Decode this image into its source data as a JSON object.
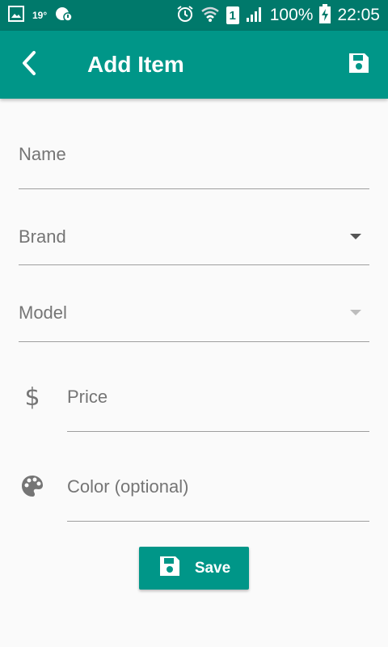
{
  "status_bar": {
    "temperature": "19°",
    "battery": "100%",
    "time": "22:05",
    "sim_slot": "1",
    "icons": [
      "gallery-icon",
      "weather-icon",
      "alarm-icon",
      "wifi-icon",
      "signal-icon",
      "battery-charging-icon"
    ]
  },
  "app_bar": {
    "title": "Add Item",
    "back_icon": "arrow-back-icon",
    "save_icon": "save-icon"
  },
  "form": {
    "name": {
      "placeholder": "Name"
    },
    "brand": {
      "placeholder": "Brand"
    },
    "model": {
      "placeholder": "Model"
    },
    "price": {
      "placeholder": "Price",
      "icon": "dollar-icon"
    },
    "color": {
      "placeholder": "Color (optional)",
      "icon": "palette-icon"
    }
  },
  "save_button": {
    "label": "Save",
    "icon": "save-icon"
  },
  "colors": {
    "accent": "#009688",
    "status_bar": "#00796b",
    "background": "#fafafa",
    "placeholder": "#757575"
  }
}
